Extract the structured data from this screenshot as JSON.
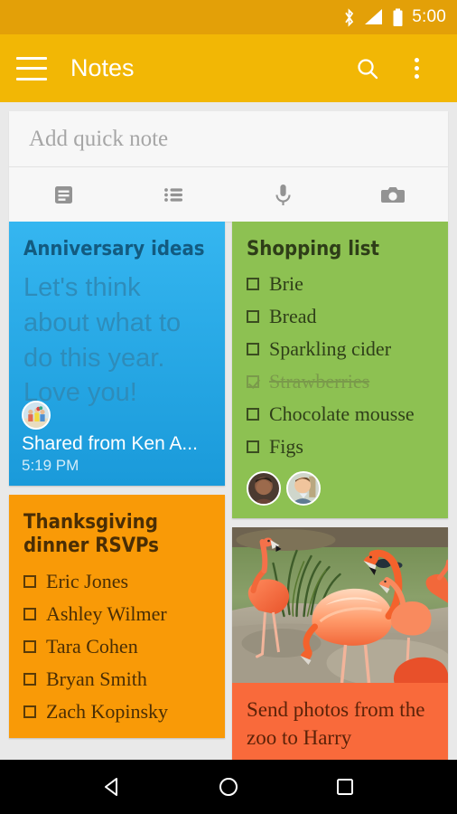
{
  "statusbar": {
    "time": "5:00",
    "icons": [
      "bluetooth-icon",
      "signal-icon",
      "battery-icon"
    ]
  },
  "appbar": {
    "title": "Notes",
    "menu_icon": "hamburger-icon",
    "search_icon": "search-icon",
    "overflow_icon": "overflow-menu-icon"
  },
  "quick_note": {
    "placeholder": "Add quick note",
    "value": "",
    "actions": [
      {
        "name": "text-note-icon",
        "label": "Text note"
      },
      {
        "name": "list-note-icon",
        "label": "List"
      },
      {
        "name": "microphone-icon",
        "label": "Voice note"
      },
      {
        "name": "camera-icon",
        "label": "Photo note"
      }
    ]
  },
  "notes": {
    "anniversary": {
      "title": "Anniversary ideas",
      "body": "Let's think about what to do this year. Love you!",
      "shared_label": "Shared from Ken A...",
      "time": "5:19 PM",
      "color": "#35b6f0"
    },
    "shopping": {
      "title": "Shopping list",
      "color": "#8dc152",
      "items": [
        {
          "label": "Brie",
          "checked": false
        },
        {
          "label": "Bread",
          "checked": false
        },
        {
          "label": "Sparkling cider",
          "checked": false
        },
        {
          "label": "Strawberries",
          "checked": true
        },
        {
          "label": "Chocolate mousse",
          "checked": false
        },
        {
          "label": "Figs",
          "checked": false
        }
      ],
      "collaborators": 2
    },
    "rsvp": {
      "title": "Thanksgiving dinner RSVPs",
      "color": "#f99a07",
      "items": [
        {
          "label": "Eric Jones",
          "checked": false
        },
        {
          "label": "Ashley Wilmer",
          "checked": false
        },
        {
          "label": "Tara Cohen",
          "checked": false
        },
        {
          "label": "Bryan Smith",
          "checked": false
        },
        {
          "label": "Zach Kopinsky",
          "checked": false
        }
      ]
    },
    "photo_note": {
      "caption": "Send photos from the zoo to Harry",
      "color": "#f96a3b",
      "image": "flamingos-at-zoo-photo"
    }
  },
  "navbar": {
    "back": "back-icon",
    "home": "home-icon",
    "recents": "recents-icon"
  }
}
